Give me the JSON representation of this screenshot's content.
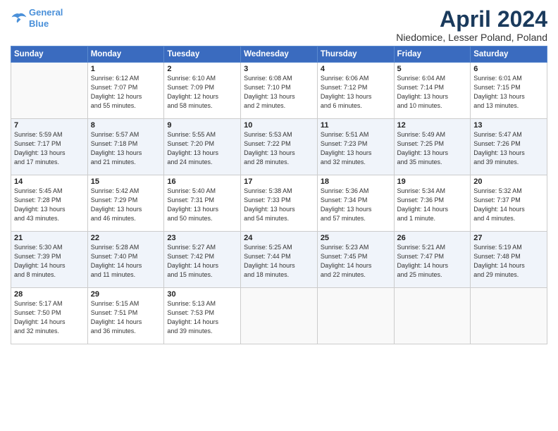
{
  "header": {
    "logo_line1": "General",
    "logo_line2": "Blue",
    "title": "April 2024",
    "subtitle": "Niedomice, Lesser Poland, Poland"
  },
  "weekdays": [
    "Sunday",
    "Monday",
    "Tuesday",
    "Wednesday",
    "Thursday",
    "Friday",
    "Saturday"
  ],
  "weeks": [
    [
      {
        "day": "",
        "info": ""
      },
      {
        "day": "1",
        "info": "Sunrise: 6:12 AM\nSunset: 7:07 PM\nDaylight: 12 hours\nand 55 minutes."
      },
      {
        "day": "2",
        "info": "Sunrise: 6:10 AM\nSunset: 7:09 PM\nDaylight: 12 hours\nand 58 minutes."
      },
      {
        "day": "3",
        "info": "Sunrise: 6:08 AM\nSunset: 7:10 PM\nDaylight: 13 hours\nand 2 minutes."
      },
      {
        "day": "4",
        "info": "Sunrise: 6:06 AM\nSunset: 7:12 PM\nDaylight: 13 hours\nand 6 minutes."
      },
      {
        "day": "5",
        "info": "Sunrise: 6:04 AM\nSunset: 7:14 PM\nDaylight: 13 hours\nand 10 minutes."
      },
      {
        "day": "6",
        "info": "Sunrise: 6:01 AM\nSunset: 7:15 PM\nDaylight: 13 hours\nand 13 minutes."
      }
    ],
    [
      {
        "day": "7",
        "info": "Sunrise: 5:59 AM\nSunset: 7:17 PM\nDaylight: 13 hours\nand 17 minutes."
      },
      {
        "day": "8",
        "info": "Sunrise: 5:57 AM\nSunset: 7:18 PM\nDaylight: 13 hours\nand 21 minutes."
      },
      {
        "day": "9",
        "info": "Sunrise: 5:55 AM\nSunset: 7:20 PM\nDaylight: 13 hours\nand 24 minutes."
      },
      {
        "day": "10",
        "info": "Sunrise: 5:53 AM\nSunset: 7:22 PM\nDaylight: 13 hours\nand 28 minutes."
      },
      {
        "day": "11",
        "info": "Sunrise: 5:51 AM\nSunset: 7:23 PM\nDaylight: 13 hours\nand 32 minutes."
      },
      {
        "day": "12",
        "info": "Sunrise: 5:49 AM\nSunset: 7:25 PM\nDaylight: 13 hours\nand 35 minutes."
      },
      {
        "day": "13",
        "info": "Sunrise: 5:47 AM\nSunset: 7:26 PM\nDaylight: 13 hours\nand 39 minutes."
      }
    ],
    [
      {
        "day": "14",
        "info": "Sunrise: 5:45 AM\nSunset: 7:28 PM\nDaylight: 13 hours\nand 43 minutes."
      },
      {
        "day": "15",
        "info": "Sunrise: 5:42 AM\nSunset: 7:29 PM\nDaylight: 13 hours\nand 46 minutes."
      },
      {
        "day": "16",
        "info": "Sunrise: 5:40 AM\nSunset: 7:31 PM\nDaylight: 13 hours\nand 50 minutes."
      },
      {
        "day": "17",
        "info": "Sunrise: 5:38 AM\nSunset: 7:33 PM\nDaylight: 13 hours\nand 54 minutes."
      },
      {
        "day": "18",
        "info": "Sunrise: 5:36 AM\nSunset: 7:34 PM\nDaylight: 13 hours\nand 57 minutes."
      },
      {
        "day": "19",
        "info": "Sunrise: 5:34 AM\nSunset: 7:36 PM\nDaylight: 14 hours\nand 1 minute."
      },
      {
        "day": "20",
        "info": "Sunrise: 5:32 AM\nSunset: 7:37 PM\nDaylight: 14 hours\nand 4 minutes."
      }
    ],
    [
      {
        "day": "21",
        "info": "Sunrise: 5:30 AM\nSunset: 7:39 PM\nDaylight: 14 hours\nand 8 minutes."
      },
      {
        "day": "22",
        "info": "Sunrise: 5:28 AM\nSunset: 7:40 PM\nDaylight: 14 hours\nand 11 minutes."
      },
      {
        "day": "23",
        "info": "Sunrise: 5:27 AM\nSunset: 7:42 PM\nDaylight: 14 hours\nand 15 minutes."
      },
      {
        "day": "24",
        "info": "Sunrise: 5:25 AM\nSunset: 7:44 PM\nDaylight: 14 hours\nand 18 minutes."
      },
      {
        "day": "25",
        "info": "Sunrise: 5:23 AM\nSunset: 7:45 PM\nDaylight: 14 hours\nand 22 minutes."
      },
      {
        "day": "26",
        "info": "Sunrise: 5:21 AM\nSunset: 7:47 PM\nDaylight: 14 hours\nand 25 minutes."
      },
      {
        "day": "27",
        "info": "Sunrise: 5:19 AM\nSunset: 7:48 PM\nDaylight: 14 hours\nand 29 minutes."
      }
    ],
    [
      {
        "day": "28",
        "info": "Sunrise: 5:17 AM\nSunset: 7:50 PM\nDaylight: 14 hours\nand 32 minutes."
      },
      {
        "day": "29",
        "info": "Sunrise: 5:15 AM\nSunset: 7:51 PM\nDaylight: 14 hours\nand 36 minutes."
      },
      {
        "day": "30",
        "info": "Sunrise: 5:13 AM\nSunset: 7:53 PM\nDaylight: 14 hours\nand 39 minutes."
      },
      {
        "day": "",
        "info": ""
      },
      {
        "day": "",
        "info": ""
      },
      {
        "day": "",
        "info": ""
      },
      {
        "day": "",
        "info": ""
      }
    ]
  ]
}
